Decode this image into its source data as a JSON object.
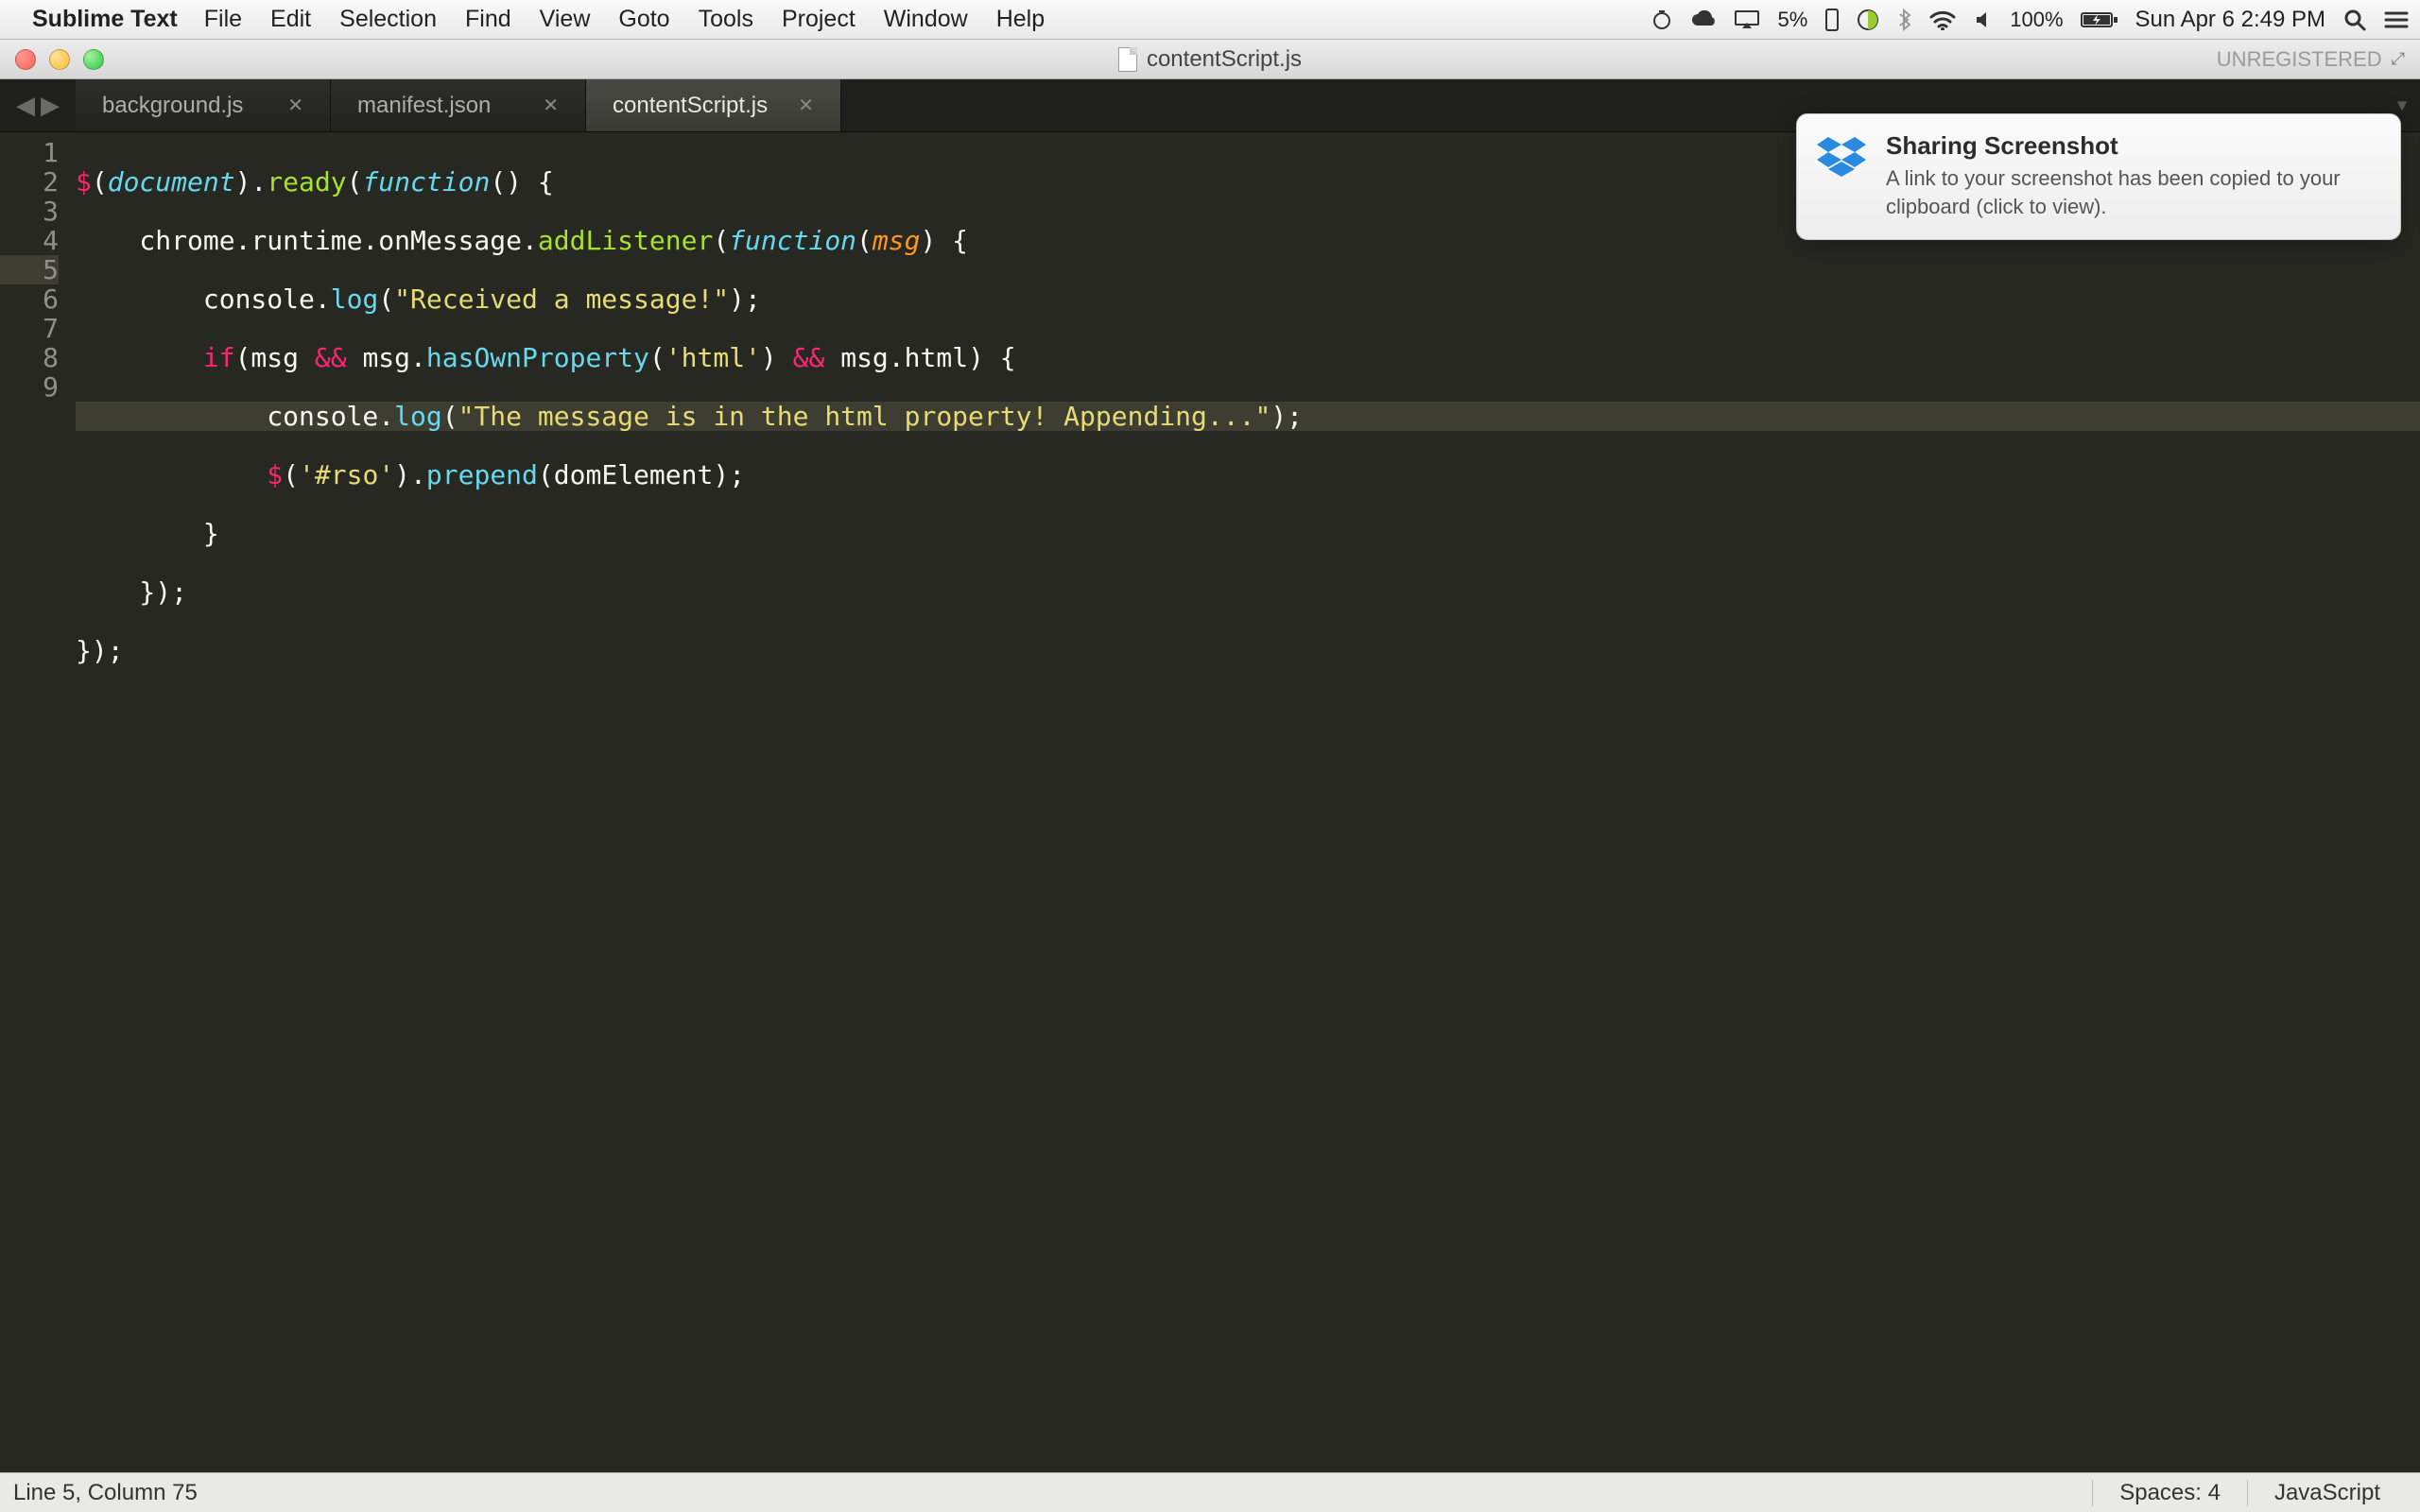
{
  "menubar": {
    "app_name": "Sublime Text",
    "menus": [
      "File",
      "Edit",
      "Selection",
      "Find",
      "View",
      "Goto",
      "Tools",
      "Project",
      "Window",
      "Help"
    ],
    "status": {
      "battery_left_pct": "5%",
      "battery_right_pct": "100%",
      "datetime": "Sun Apr 6  2:49 PM"
    }
  },
  "window": {
    "title": "contentScript.js",
    "registration": "UNREGISTERED"
  },
  "tabs": [
    {
      "label": "background.js",
      "active": false
    },
    {
      "label": "manifest.json",
      "active": false
    },
    {
      "label": "contentScript.js",
      "active": true
    }
  ],
  "editor": {
    "line_numbers": [
      "1",
      "2",
      "3",
      "4",
      "5",
      "6",
      "7",
      "8",
      "9"
    ],
    "highlight_line": 5,
    "code": {
      "l1": {
        "a": "$",
        "b": "(",
        "c": "document",
        "d": ").",
        "e": "ready",
        "f": "(",
        "g": "function",
        "h": "() {"
      },
      "l2": {
        "a": "    chrome.runtime.onMessage.",
        "b": "addListener",
        "c": "(",
        "d": "function",
        "e": "(",
        "f": "msg",
        "g": ") {"
      },
      "l3": {
        "a": "        console.",
        "b": "log",
        "c": "(",
        "d": "\"Received a message!\"",
        "e": ");"
      },
      "l4": {
        "a": "        ",
        "b": "if",
        "c": "(msg ",
        "d": "&&",
        "e": " msg.",
        "f": "hasOwnProperty",
        "g": "(",
        "h": "'html'",
        "i": ") ",
        "j": "&&",
        "k": " msg.html) {"
      },
      "l5": {
        "a": "            console.",
        "b": "log",
        "c": "(",
        "d": "\"The message is in the html property! Appending...\"",
        "e": ");"
      },
      "l6": {
        "a": "            ",
        "b": "$",
        "c": "(",
        "d": "'#rso'",
        "e": ").",
        "f": "prepend",
        "g": "(domElement);"
      },
      "l7": {
        "a": "        }"
      },
      "l8": {
        "a": "    });"
      },
      "l9": {
        "a": "});"
      }
    }
  },
  "statusbar": {
    "position": "Line 5, Column 75",
    "spaces": "Spaces: 4",
    "language": "JavaScript"
  },
  "notification": {
    "title": "Sharing Screenshot",
    "body": "A link to your screenshot has been copied to your clipboard (click to view)."
  }
}
